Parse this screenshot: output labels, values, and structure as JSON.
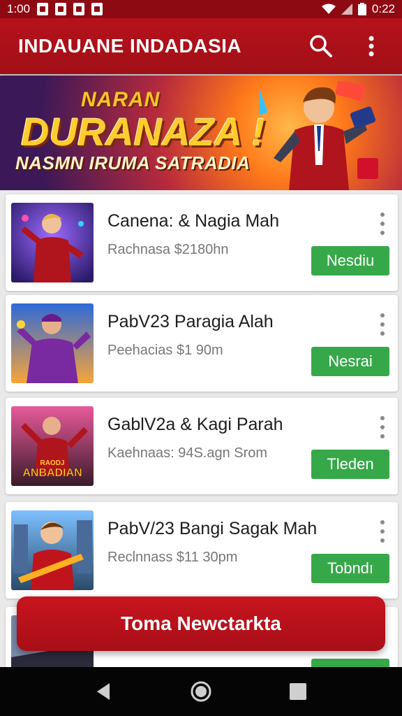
{
  "status_bar": {
    "time_left": "1:00",
    "time_right": "0:22"
  },
  "app_bar": {
    "title": "INDAUANE INDADASIA",
    "search_icon": "search-icon",
    "more_icon": "more-vert-icon"
  },
  "banner": {
    "line1": "NARAN",
    "line2": "DURANAZA !",
    "line3": "NASMN IRUMA SATRADIA"
  },
  "items": [
    {
      "title": "Canena: & Nagia Mah",
      "subtitle": "Rachnasa $2180hn",
      "button": "Nesdiu"
    },
    {
      "title": "PabV23 Paragia Alah",
      "subtitle": "Peehacias $1 90m",
      "button": "Nesrai"
    },
    {
      "title": "GablV2a & Kagi Parah",
      "subtitle": "Kaehnaas: 94S.agn Srom",
      "button": "Tleden",
      "thumb_text_1": "RAODJ",
      "thumb_text_2": "ANBADIAN"
    },
    {
      "title": "PabV/23 Bangi Sagak Mah",
      "subtitle": "Reclnnass $11 30pm",
      "button": "Tobndı"
    },
    {
      "title": "",
      "subtitle": "",
      "button": ""
    }
  ],
  "cta": {
    "label": "Toma Newctarkta"
  },
  "colors": {
    "primary": "#b5121b",
    "accent_green": "#37a849",
    "status_bar": "#8e0a12"
  }
}
